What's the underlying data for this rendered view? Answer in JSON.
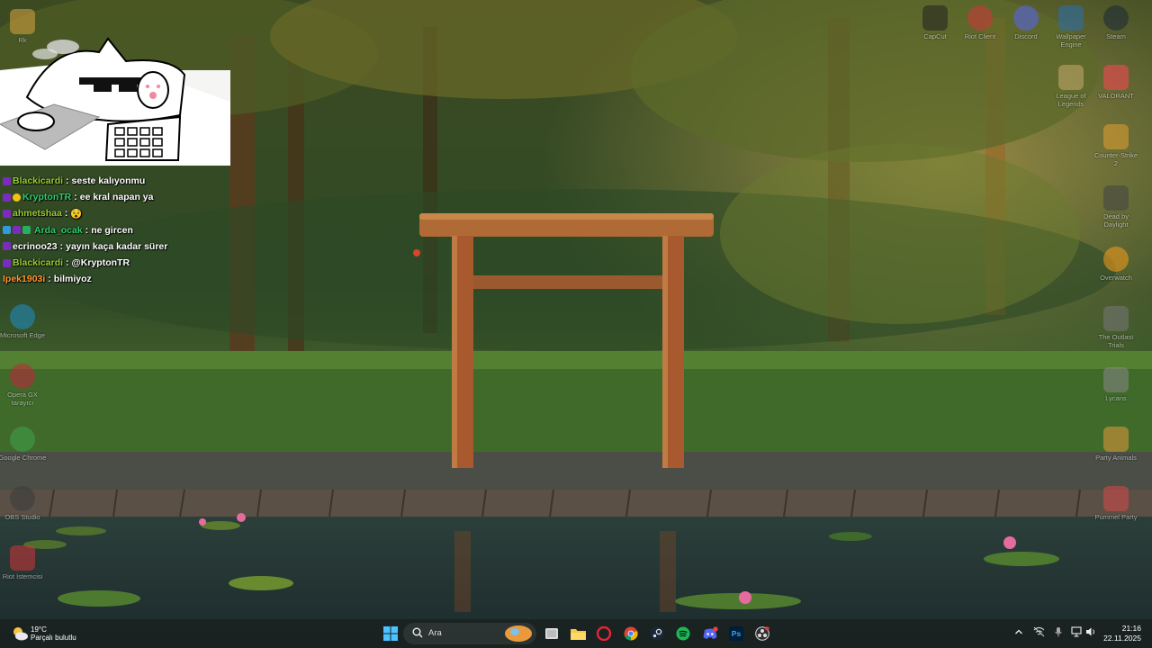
{
  "desktop": {
    "left_icons": [
      {
        "label": "Rk",
        "icon": "folder-icon",
        "color": "#d9a441"
      },
      {
        "label": "Microsoft Edge",
        "icon": "edge-icon",
        "color": "#1f8ec9"
      },
      {
        "label": "Opera GX tarayıcı",
        "icon": "opera-gx-icon",
        "color": "#c2263d"
      },
      {
        "label": "Google Chrome",
        "icon": "chrome-icon",
        "color": "#3fa34d"
      },
      {
        "label": "OBS Studio",
        "icon": "obs-icon",
        "color": "#3b3b3b"
      },
      {
        "label": "Riot İstemcisi",
        "icon": "riot-icon",
        "color": "#d13639"
      }
    ],
    "right_icons": [
      {
        "label": "CapCut",
        "icon": "capcut-icon",
        "color": "#222222"
      },
      {
        "label": "Riot Client",
        "icon": "riot-client-icon",
        "color": "#d13639"
      },
      {
        "label": "Discord",
        "icon": "discord-icon",
        "color": "#5865f2"
      },
      {
        "label": "Wallpaper Engine",
        "icon": "wallpaper-engine-icon",
        "color": "#2a6fb0"
      },
      {
        "label": "Steam",
        "icon": "steam-icon",
        "color": "#1b2838"
      },
      {
        "label": "League of Legends",
        "icon": "league-icon",
        "color": "#c8aa6e"
      },
      {
        "label": "VALORANT",
        "icon": "valorant-icon",
        "color": "#ff4655"
      },
      {
        "label": "Counter-Strike 2",
        "icon": "cs2-icon",
        "color": "#e0a030"
      },
      {
        "label": "Dead by Daylight",
        "icon": "dbd-icon",
        "color": "#444444"
      },
      {
        "label": "Overwatch",
        "icon": "overwatch-icon",
        "color": "#f99e1a"
      },
      {
        "label": "The Outlast Trials",
        "icon": "outlast-icon",
        "color": "#777777"
      },
      {
        "label": "Lycans",
        "icon": "lycans-icon",
        "color": "#888888"
      },
      {
        "label": "Party Animals",
        "icon": "party-animals-icon",
        "color": "#e59a3c"
      },
      {
        "label": "Pummel Party",
        "icon": "pummel-party-icon",
        "color": "#d64a4a"
      }
    ]
  },
  "chat": [
    {
      "user": "Blackicardi",
      "message": "seste kalıyonmu",
      "color": "#9acd32",
      "badge": "#7b2cbf"
    },
    {
      "user": "KryptonTR",
      "message": "ee kral napan ya",
      "color": "#2ecc71",
      "badge": "#f1c40f"
    },
    {
      "user": "ahmetshaa",
      "message": "😵",
      "color": "#9acd32",
      "badge": "#7b2cbf"
    },
    {
      "user": "Arda_ocak",
      "message": "ne gircen",
      "color": "#2ecc71",
      "badge": "#3498db"
    },
    {
      "user": "ecrinoo23",
      "message": "yayın kaça kadar sürer",
      "color": "#ffffff",
      "badge": "#7b2cbf"
    },
    {
      "user": "Blackicardi",
      "message": "@KryptonTR",
      "color": "#9acd32",
      "badge": "#7b2cbf"
    },
    {
      "user": "Ipek1903i",
      "message": "bilmiyoz",
      "color": "#ff9933",
      "badge": ""
    }
  ],
  "taskbar": {
    "weather_temp": "19°C",
    "weather_desc": "Parçalı bulutlu",
    "search_placeholder": "Ara",
    "apps": [
      "widgets-icon",
      "task-view-icon",
      "file-explorer-icon",
      "opera-gx-icon",
      "chrome-icon",
      "steam-icon",
      "spotify-icon",
      "discord-icon",
      "photoshop-icon",
      "obs-icon"
    ],
    "photoshop_label": "Ps",
    "time": "21:16",
    "date": "22.11.2025"
  }
}
